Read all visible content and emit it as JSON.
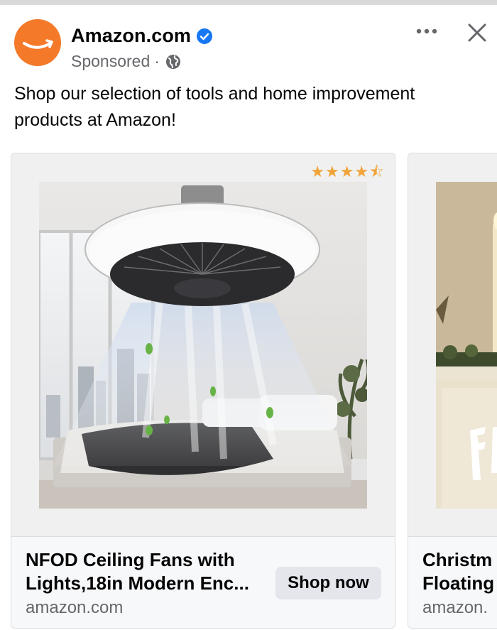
{
  "header": {
    "page_name": "Amazon.com",
    "sponsored": "Sponsored",
    "separator": "·"
  },
  "post": {
    "caption": "Shop our selection of tools and home improvement products at Amazon!"
  },
  "cards": [
    {
      "title_line1": "NFOD Ceiling Fans with",
      "title_line2": "Lights,18in Modern Enc...",
      "domain": "amazon.com",
      "cta": "Shop now",
      "rating_stars": 4.5,
      "stars": "★★★★⯪"
    },
    {
      "title_line1": "Christm",
      "title_line2": "Floating",
      "domain": "amazon."
    }
  ],
  "icons": {
    "avatar": "amazon-smile-logo",
    "verified": "verified-badge-icon",
    "audience": "globe-icon",
    "more": "more-options-icon",
    "close": "close-icon"
  },
  "colors": {
    "brand_orange": "#f47a2a",
    "verified_blue": "#1877f2",
    "star": "#f0a43a",
    "button_bg": "#e4e6eb",
    "secondary_text": "#65676b"
  }
}
